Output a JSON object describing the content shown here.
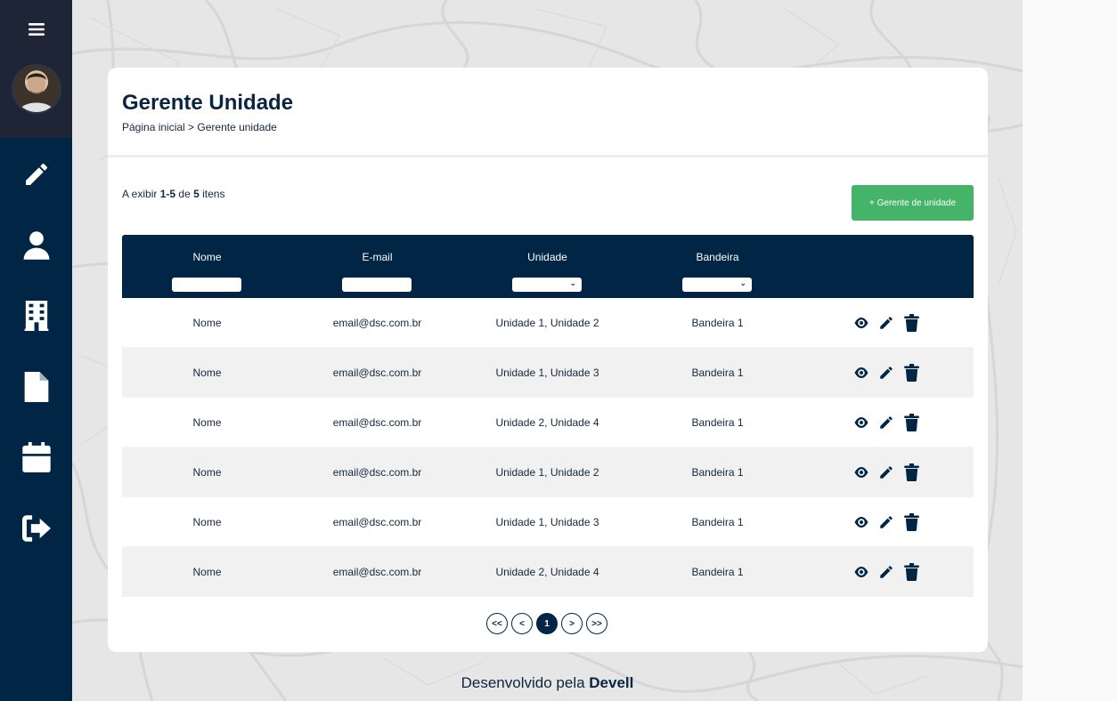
{
  "sidebar": {
    "items": [
      {
        "icon": "pencil-icon"
      },
      {
        "icon": "user-icon"
      },
      {
        "icon": "building-icon"
      },
      {
        "icon": "document-icon"
      },
      {
        "icon": "calendar-icon"
      },
      {
        "icon": "logout-icon"
      }
    ]
  },
  "header": {
    "title": "Gerente Unidade",
    "breadcrumb": "Página inicial > Gerente unidade"
  },
  "summary": {
    "prefix": "A exibir",
    "range": "1-5",
    "of": "de",
    "total": "5",
    "suffix": "itens"
  },
  "add_button": "+ Gerente de unidade",
  "table": {
    "columns": [
      "Nome",
      "E-mail",
      "Unidade",
      "Bandeira"
    ],
    "rows": [
      {
        "nome": "Nome",
        "email": "email@dsc.com.br",
        "unidade": "Unidade 1, Unidade 2",
        "bandeira": "Bandeira 1"
      },
      {
        "nome": "Nome",
        "email": "email@dsc.com.br",
        "unidade": "Unidade 1, Unidade 3",
        "bandeira": "Bandeira 1"
      },
      {
        "nome": "Nome",
        "email": "email@dsc.com.br",
        "unidade": "Unidade 2, Unidade 4",
        "bandeira": "Bandeira 1"
      },
      {
        "nome": "Nome",
        "email": "email@dsc.com.br",
        "unidade": "Unidade 1, Unidade 2",
        "bandeira": "Bandeira 1"
      },
      {
        "nome": "Nome",
        "email": "email@dsc.com.br",
        "unidade": "Unidade 1, Unidade 3",
        "bandeira": "Bandeira 1"
      },
      {
        "nome": "Nome",
        "email": "email@dsc.com.br",
        "unidade": "Unidade 2, Unidade 4",
        "bandeira": "Bandeira 1"
      }
    ]
  },
  "pagination": {
    "first": "<<",
    "prev": "<",
    "current": "1",
    "next": ">",
    "last": ">>"
  },
  "footer": {
    "prefix": "Desenvolvido pela",
    "brand": "Devell"
  },
  "colors": {
    "primary": "#012544",
    "accent": "#45b469",
    "background": "#e9e9ea"
  }
}
